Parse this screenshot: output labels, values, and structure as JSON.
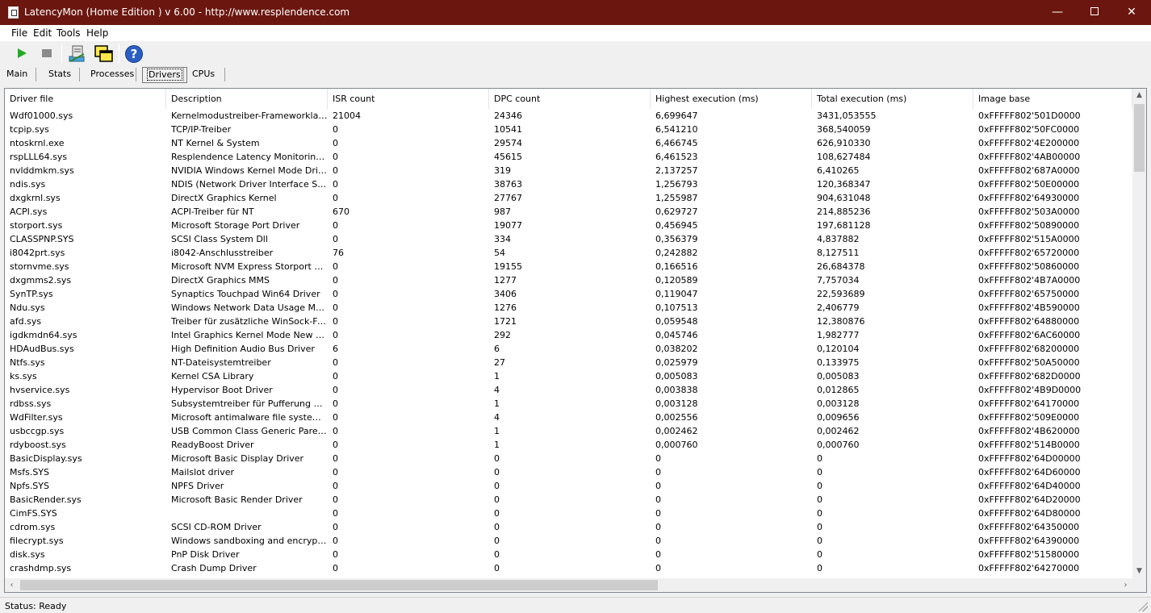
{
  "window": {
    "title": "LatencyMon  (Home Edition )  v 6.00 - http://www.resplendence.com",
    "minimize_glyph": "—",
    "close_glyph": "✕"
  },
  "menu": [
    "File",
    "Edit",
    "Tools",
    "Help"
  ],
  "toolbar": {
    "icons": [
      "play-icon",
      "stop-icon",
      "report-icon",
      "windows-icon",
      "help-icon"
    ],
    "help_glyph": "?"
  },
  "tabs": [
    "Main",
    "Stats",
    "Processes",
    "Drivers",
    "CPUs"
  ],
  "active_tab": "Drivers",
  "table": {
    "columns": [
      "Driver file",
      "Description",
      "ISR count",
      "DPC count",
      "Highest execution (ms)",
      "Total execution (ms)",
      "Image base"
    ],
    "rows": [
      [
        "Wdf01000.sys",
        "Kernelmodustreiber-Frameworklaufzeit",
        "21004",
        "24346",
        "6,699647",
        "3431,053555",
        "0xFFFFF802'501D0000"
      ],
      [
        "tcpip.sys",
        "TCP/IP-Treiber",
        "0",
        "10541",
        "6,541210",
        "368,540059",
        "0xFFFFF802'50FC0000"
      ],
      [
        "ntoskrnl.exe",
        "NT Kernel & System",
        "0",
        "29574",
        "6,466745",
        "626,910330",
        "0xFFFFF802'4E200000"
      ],
      [
        "rspLLL64.sys",
        "Resplendence Latency Monitoring a…",
        "0",
        "45615",
        "6,461523",
        "108,627484",
        "0xFFFFF802'4AB00000"
      ],
      [
        "nvlddmkm.sys",
        "NVIDIA Windows Kernel Mode Drive…",
        "0",
        "319",
        "2,137257",
        "6,410265",
        "0xFFFFF802'687A0000"
      ],
      [
        "ndis.sys",
        "NDIS (Network Driver Interface Spe…",
        "0",
        "38763",
        "1,256793",
        "120,368347",
        "0xFFFFF802'50E00000"
      ],
      [
        "dxgkrnl.sys",
        "DirectX Graphics Kernel",
        "0",
        "27767",
        "1,255987",
        "904,631048",
        "0xFFFFF802'64930000"
      ],
      [
        "ACPI.sys",
        "ACPI-Treiber für NT",
        "670",
        "987",
        "0,629727",
        "214,885236",
        "0xFFFFF802'503A0000"
      ],
      [
        "storport.sys",
        "Microsoft Storage Port Driver",
        "0",
        "19077",
        "0,456945",
        "197,681128",
        "0xFFFFF802'50890000"
      ],
      [
        "CLASSPNP.SYS",
        "SCSI Class System Dll",
        "0",
        "334",
        "0,356379",
        "4,837882",
        "0xFFFFF802'515A0000"
      ],
      [
        "i8042prt.sys",
        "i8042-Anschlusstreiber",
        "76",
        "54",
        "0,242882",
        "8,127511",
        "0xFFFFF802'65720000"
      ],
      [
        "stornvme.sys",
        "Microsoft NVM Express Storport Mini…",
        "0",
        "19155",
        "0,166516",
        "26,684378",
        "0xFFFFF802'50860000"
      ],
      [
        "dxgmms2.sys",
        "DirectX Graphics MMS",
        "0",
        "1277",
        "0,120589",
        "7,757034",
        "0xFFFFF802'4B7A0000"
      ],
      [
        "SynTP.sys",
        "Synaptics Touchpad Win64 Driver",
        "0",
        "3406",
        "0,119047",
        "22,593689",
        "0xFFFFF802'65750000"
      ],
      [
        "Ndu.sys",
        "Windows Network Data Usage Monit…",
        "0",
        "1276",
        "0,107513",
        "2,406779",
        "0xFFFFF802'4B590000"
      ],
      [
        "afd.sys",
        "Treiber für zusätzliche WinSock-Fun…",
        "0",
        "1721",
        "0,059548",
        "12,380876",
        "0xFFFFF802'64880000"
      ],
      [
        "igdkmdn64.sys",
        "Intel Graphics Kernel Mode New Driver",
        "0",
        "292",
        "0,045746",
        "1,982777",
        "0xFFFFF802'6AC60000"
      ],
      [
        "HDAudBus.sys",
        "High Definition Audio Bus Driver",
        "6",
        "6",
        "0,038202",
        "0,120104",
        "0xFFFFF802'68200000"
      ],
      [
        "Ntfs.sys",
        "NT-Dateisystemtreiber",
        "0",
        "27",
        "0,025979",
        "0,133975",
        "0xFFFFF802'50A50000"
      ],
      [
        "ks.sys",
        "Kernel CSA Library",
        "0",
        "1",
        "0,005083",
        "0,005083",
        "0xFFFFF802'682D0000"
      ],
      [
        "hvservice.sys",
        "Hypervisor Boot Driver",
        "0",
        "4",
        "0,003838",
        "0,012865",
        "0xFFFFF802'4B9D0000"
      ],
      [
        "rdbss.sys",
        "Subsystemtreiber für Pufferung des…",
        "0",
        "1",
        "0,003128",
        "0,003128",
        "0xFFFFF802'64170000"
      ],
      [
        "WdFilter.sys",
        "Microsoft antimalware file system filt…",
        "0",
        "4",
        "0,002556",
        "0,009656",
        "0xFFFFF802'509E0000"
      ],
      [
        "usbccgp.sys",
        "USB Common Class Generic Parent …",
        "0",
        "1",
        "0,002462",
        "0,002462",
        "0xFFFFF802'4B620000"
      ],
      [
        "rdyboost.sys",
        "ReadyBoost Driver",
        "0",
        "1",
        "0,000760",
        "0,000760",
        "0xFFFFF802'514B0000"
      ],
      [
        "BasicDisplay.sys",
        "Microsoft Basic Display Driver",
        "0",
        "0",
        "0",
        "0",
        "0xFFFFF802'64D00000"
      ],
      [
        "Msfs.SYS",
        "Mailslot driver",
        "0",
        "0",
        "0",
        "0",
        "0xFFFFF802'64D60000"
      ],
      [
        "Npfs.SYS",
        "NPFS Driver",
        "0",
        "0",
        "0",
        "0",
        "0xFFFFF802'64D40000"
      ],
      [
        "BasicRender.sys",
        "Microsoft Basic Render Driver",
        "0",
        "0",
        "0",
        "0",
        "0xFFFFF802'64D20000"
      ],
      [
        "CimFS.SYS",
        "",
        "0",
        "0",
        "0",
        "0",
        "0xFFFFF802'64D80000"
      ],
      [
        "cdrom.sys",
        "SCSI CD-ROM Driver",
        "0",
        "0",
        "0",
        "0",
        "0xFFFFF802'64350000"
      ],
      [
        "filecrypt.sys",
        "Windows sandboxing and encryptio…",
        "0",
        "0",
        "0",
        "0",
        "0xFFFFF802'64390000"
      ],
      [
        "disk.sys",
        "PnP Disk Driver",
        "0",
        "0",
        "0",
        "0",
        "0xFFFFF802'51580000"
      ],
      [
        "crashdmp.sys",
        "Crash Dump Driver",
        "0",
        "0",
        "0",
        "0",
        "0xFFFFF802'64270000"
      ]
    ]
  },
  "scroll_glyphs": {
    "up": "▲",
    "down": "▼",
    "left": "‹",
    "right": "›"
  },
  "status": "Status: Ready"
}
